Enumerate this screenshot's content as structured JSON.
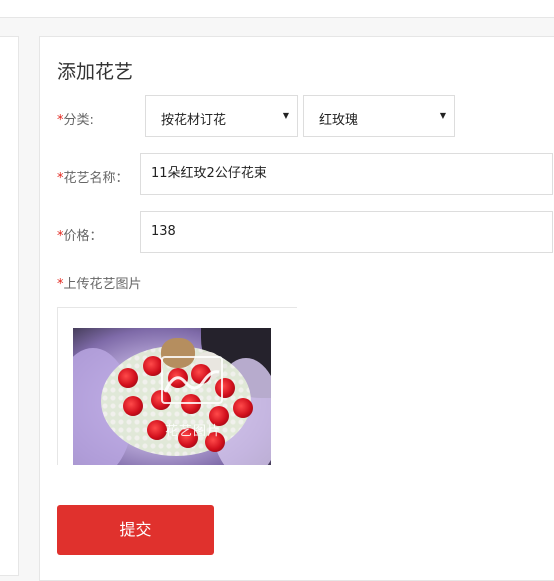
{
  "form": {
    "title": "添加花艺",
    "category": {
      "required_mark": "*",
      "label": "分类:",
      "primary_value": "按花材订花",
      "secondary_value": "红玫瑰"
    },
    "name": {
      "required_mark": "*",
      "label": "花艺名称：",
      "value": "11朵红玫2公仔花束"
    },
    "price": {
      "required_mark": "*",
      "label": "价格：",
      "value": "138"
    },
    "upload": {
      "required_mark": "*",
      "label": "上传花艺图片",
      "overlay_text": "花艺图片"
    },
    "submit_label": "提交"
  },
  "colors": {
    "accent": "#e0312d",
    "required": "#e2231a"
  }
}
